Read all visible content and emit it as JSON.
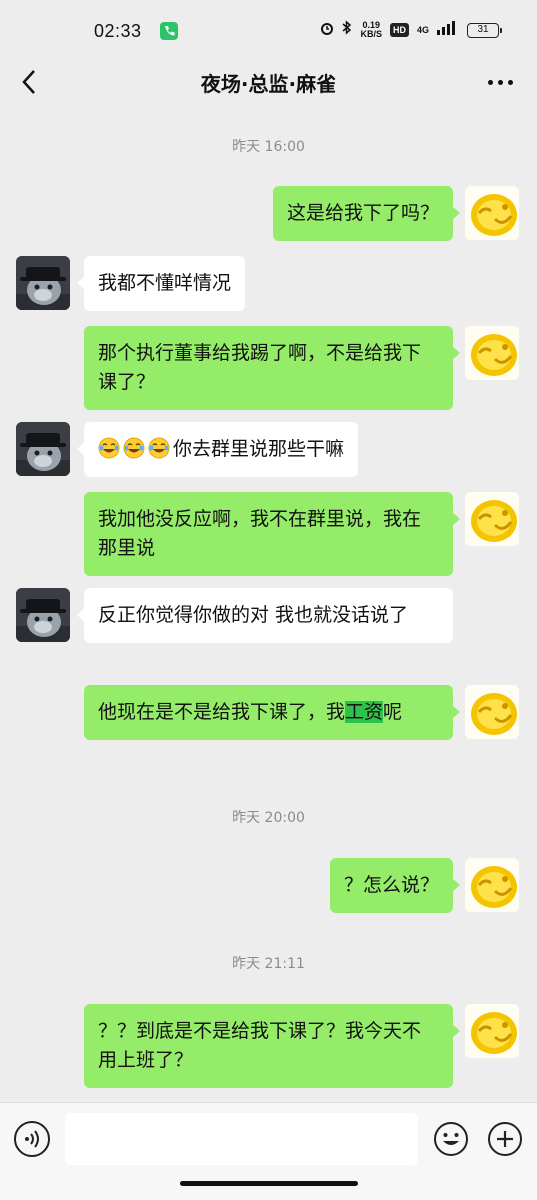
{
  "status_bar": {
    "time": "02:33",
    "speed_value": "0.19",
    "speed_unit": "KB/S",
    "hd": "HD",
    "network": "4G",
    "battery": "31"
  },
  "header": {
    "title": "夜场·总监·麻雀"
  },
  "messages": {
    "ts1": "昨天 16:00",
    "m1": "这是给我下了吗？",
    "m2": "我都不懂咩情况",
    "m3": "那个执行董事给我踢了啊，不是给我下课了？",
    "m4": "你去群里说那些干嘛",
    "m5": "我加他没反应啊，我不在群里说，我在那里说",
    "m6": "反正你觉得你做的对 我也就没话说了",
    "m7_before": "他现在是不是给我下课了，我",
    "m7_highlight": "工资",
    "m7_after": "呢",
    "ts2": "昨天 20:00",
    "m8": "？怎么说？",
    "ts3": "昨天 21:11",
    "m9": "？？到底是不是给我下课了？我今天不用上班了？"
  },
  "colors": {
    "my_bubble": "#95ec69",
    "their_bubble": "#ffffff",
    "background": "#ededed",
    "highlight": "#2fc24a"
  },
  "icons": {
    "back": "chevron-left-icon",
    "more": "more-dots-icon",
    "voice": "voice-icon",
    "emoji": "emoji-icon",
    "plus": "plus-icon",
    "laugh_cry": "laugh-cry-emoji-icon"
  }
}
